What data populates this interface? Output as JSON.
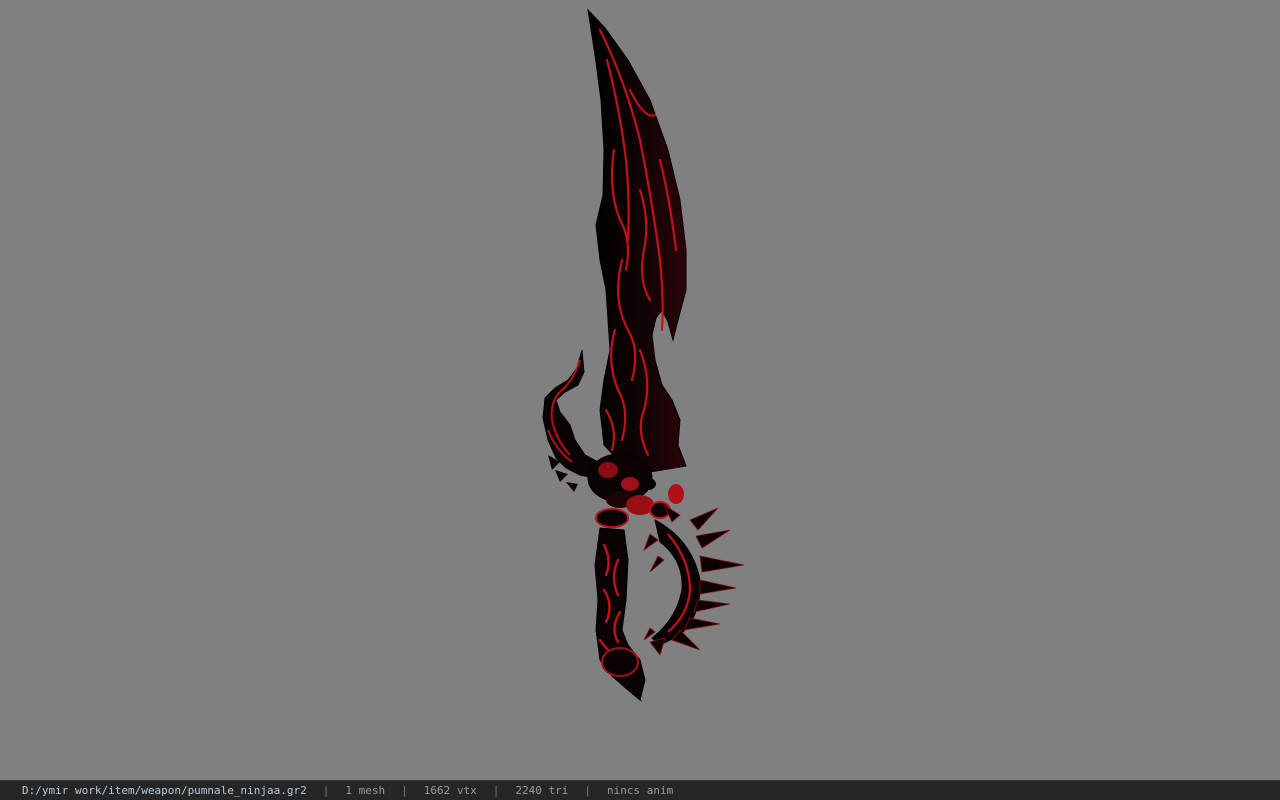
{
  "viewport": {
    "background_color": "#808080",
    "model": {
      "description_icon": "dagger-model",
      "base_color": "#0a0a0a",
      "pattern_color": "#c0121a"
    }
  },
  "status_bar": {
    "file_path": "D:/ymir work/item/weapon/pumnale_ninjaa.gr2",
    "separator": "|",
    "mesh_count": "1 mesh",
    "vertex_count": "1662 vtx",
    "triangle_count": "2240 tri",
    "anim_status": "nincs anim"
  }
}
